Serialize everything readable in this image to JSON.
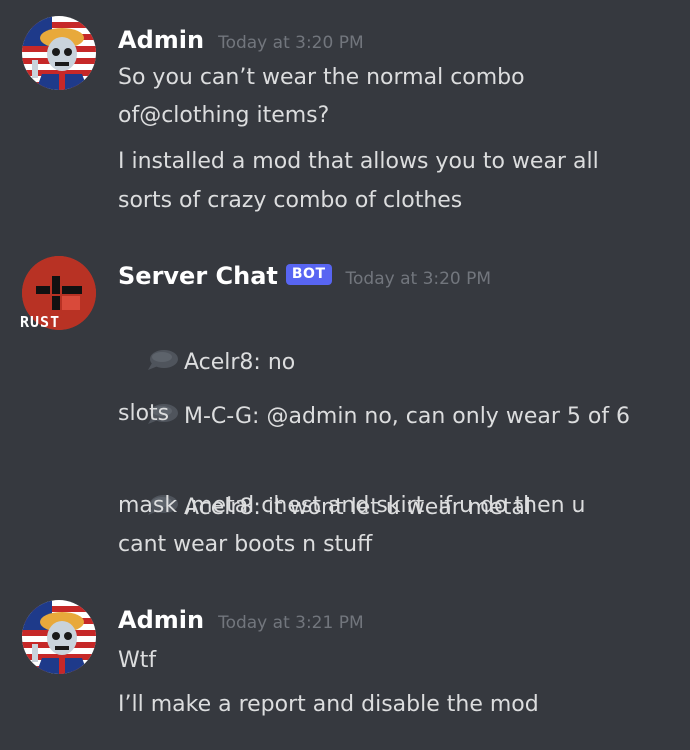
{
  "messages": [
    {
      "username": "Admin",
      "timestamp": "Today at 3:20 PM",
      "avatar": "patriotic-skull-avatar",
      "lines": [
        "So you can’t wear the normal combo",
        "of@clothing items?",
        "I installed a mod that allows you to wear all",
        "sorts of crazy combo of clothes"
      ]
    },
    {
      "username": "Server Chat",
      "bot_tag": "BOT",
      "timestamp": "Today at 3:20 PM",
      "avatar": "rust-logo-avatar",
      "avatar_label": "RUST",
      "lines": [
        "Acelr8: no",
        "M-C-G: @admin no, can only wear 5 of 6",
        "slots",
        "Acelr8: it wont let u wear metal",
        "mask ,metal chest and skirt  if u do then u",
        "cant wear boots n stuff"
      ]
    },
    {
      "username": "Admin",
      "timestamp": "Today at 3:21 PM",
      "avatar": "patriotic-skull-avatar",
      "lines": [
        "Wtf",
        "I’ll make a report and disable the mod"
      ]
    }
  ],
  "colors": {
    "background": "#36393f",
    "username": "#ffffff",
    "text": "#dcddde",
    "timestamp": "#72767d",
    "bot_tag": "#5865f2",
    "rust_red": "#c0392b"
  }
}
